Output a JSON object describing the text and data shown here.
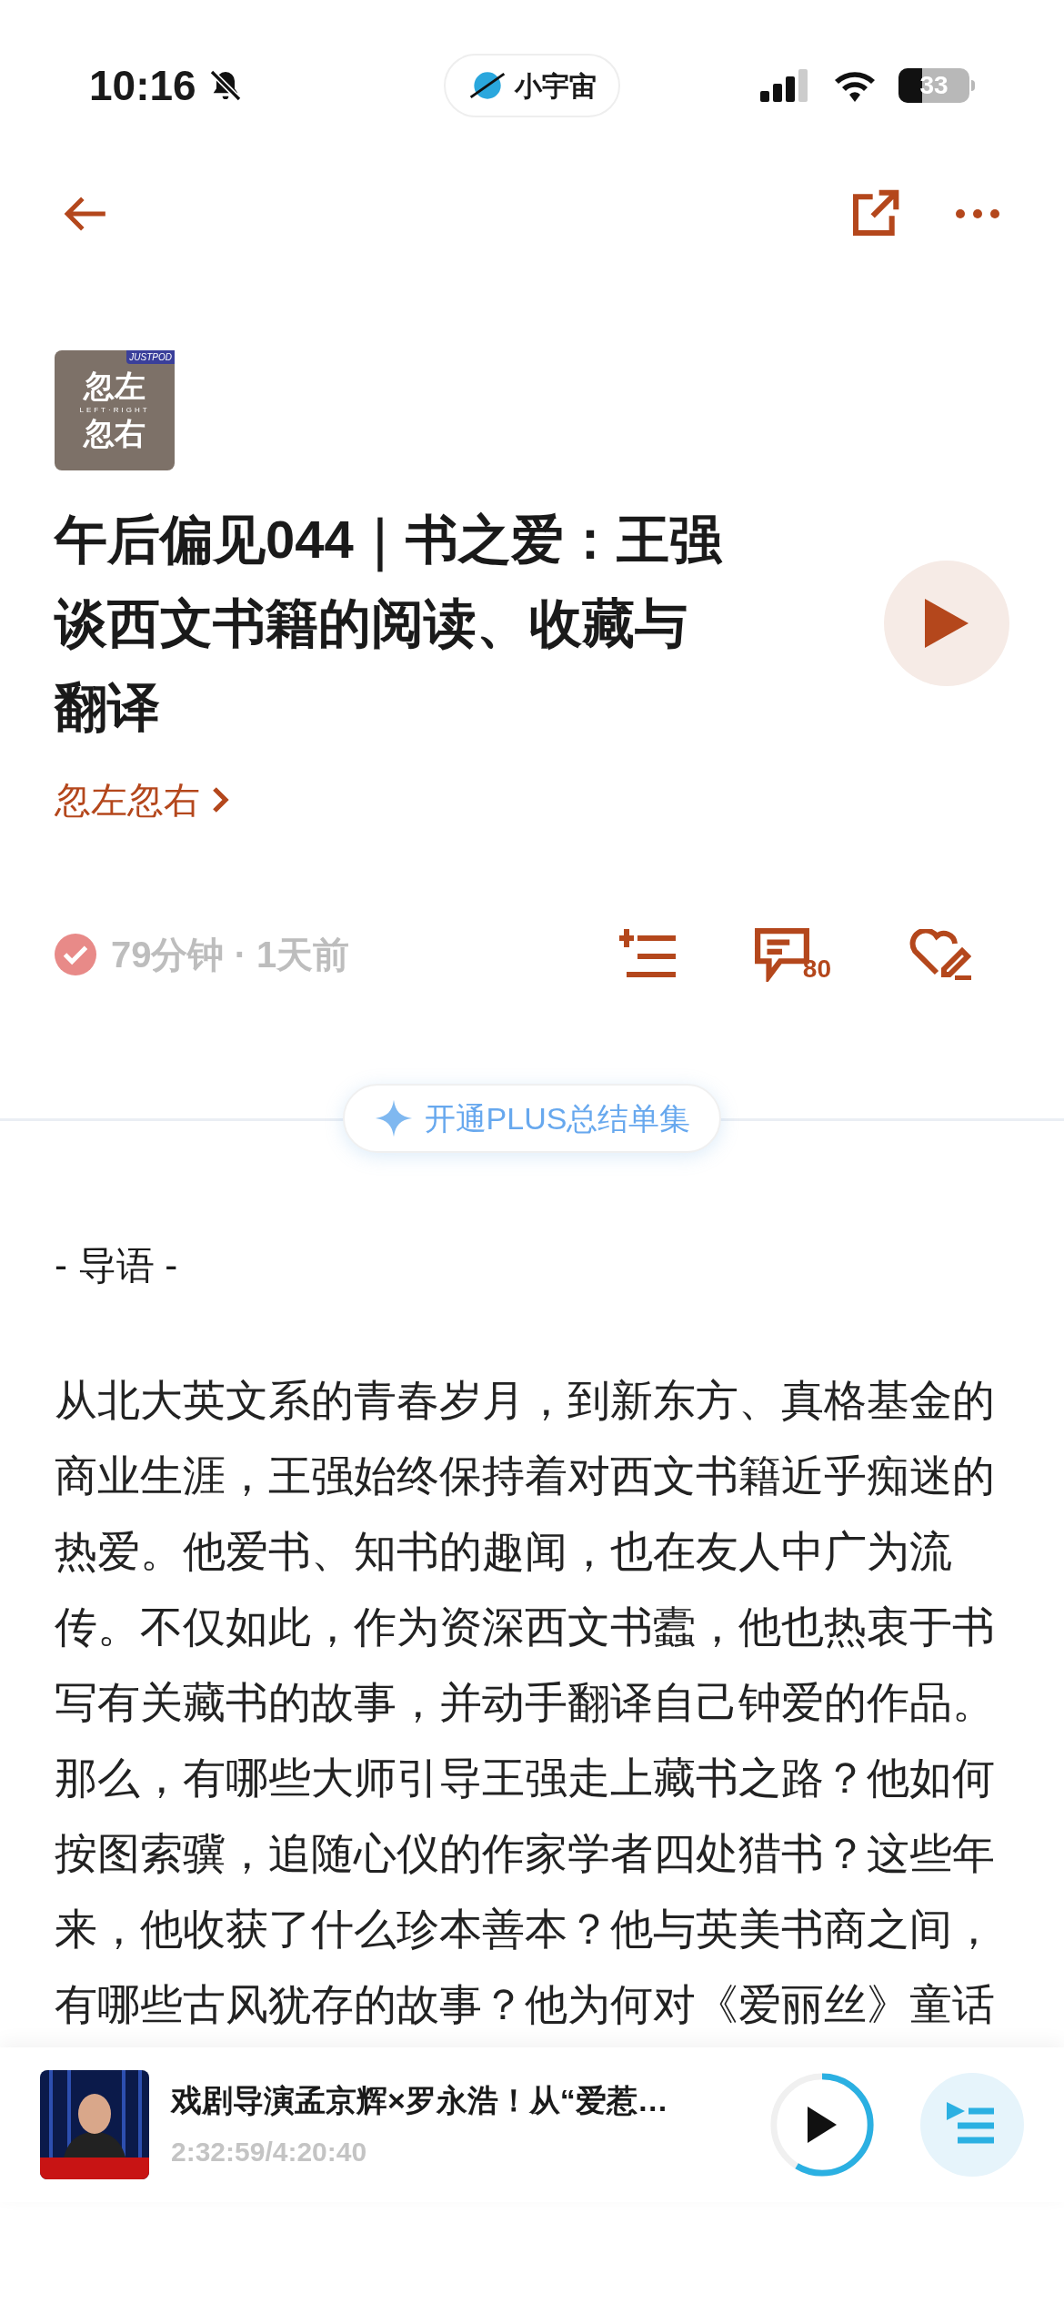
{
  "status_bar": {
    "time": "10:16",
    "app_pill": "小宇宙",
    "battery": "33"
  },
  "episode": {
    "cover": {
      "line1": "忽左",
      "subtitle": "LEFT·RIGHT",
      "line2": "忽右",
      "badge": "JUSTPOD"
    },
    "title": "午后偏见044｜书之爱：王强谈西文书籍的阅读、收藏与翻译",
    "podcast": "忽左忽右",
    "played": true,
    "duration": "79分钟",
    "dot": "·",
    "age": "1天前",
    "comment_count": "80"
  },
  "plus_button": "开通PLUS总结单集",
  "intro": {
    "heading": "- 导语 -",
    "body": "从北大英文系的青春岁月，到新东方、真格基金的商业生涯，王强始终保持着对西文书籍近乎痴迷的热爱。他爱书、知书的趣闻，也在友人中广为流传。不仅如此，作为资深西文书蠹，他也热衷于书写有关藏书的故事，并动手翻译自己钟爱的作品。那么，有哪些大师引导王强走上藏书之路？他如何按图索骥，追随心仪的作家学者四处猎书？这些年来，他收获了什么珍本善本？他与英美书商之间，有哪些古风犹存的故事？他为何对《爱丽丝》童话"
  },
  "player": {
    "title": "戏剧导演孟京辉×罗永浩！从“爱惹…",
    "time": "2:32:59/4:20:40",
    "playing": false
  }
}
